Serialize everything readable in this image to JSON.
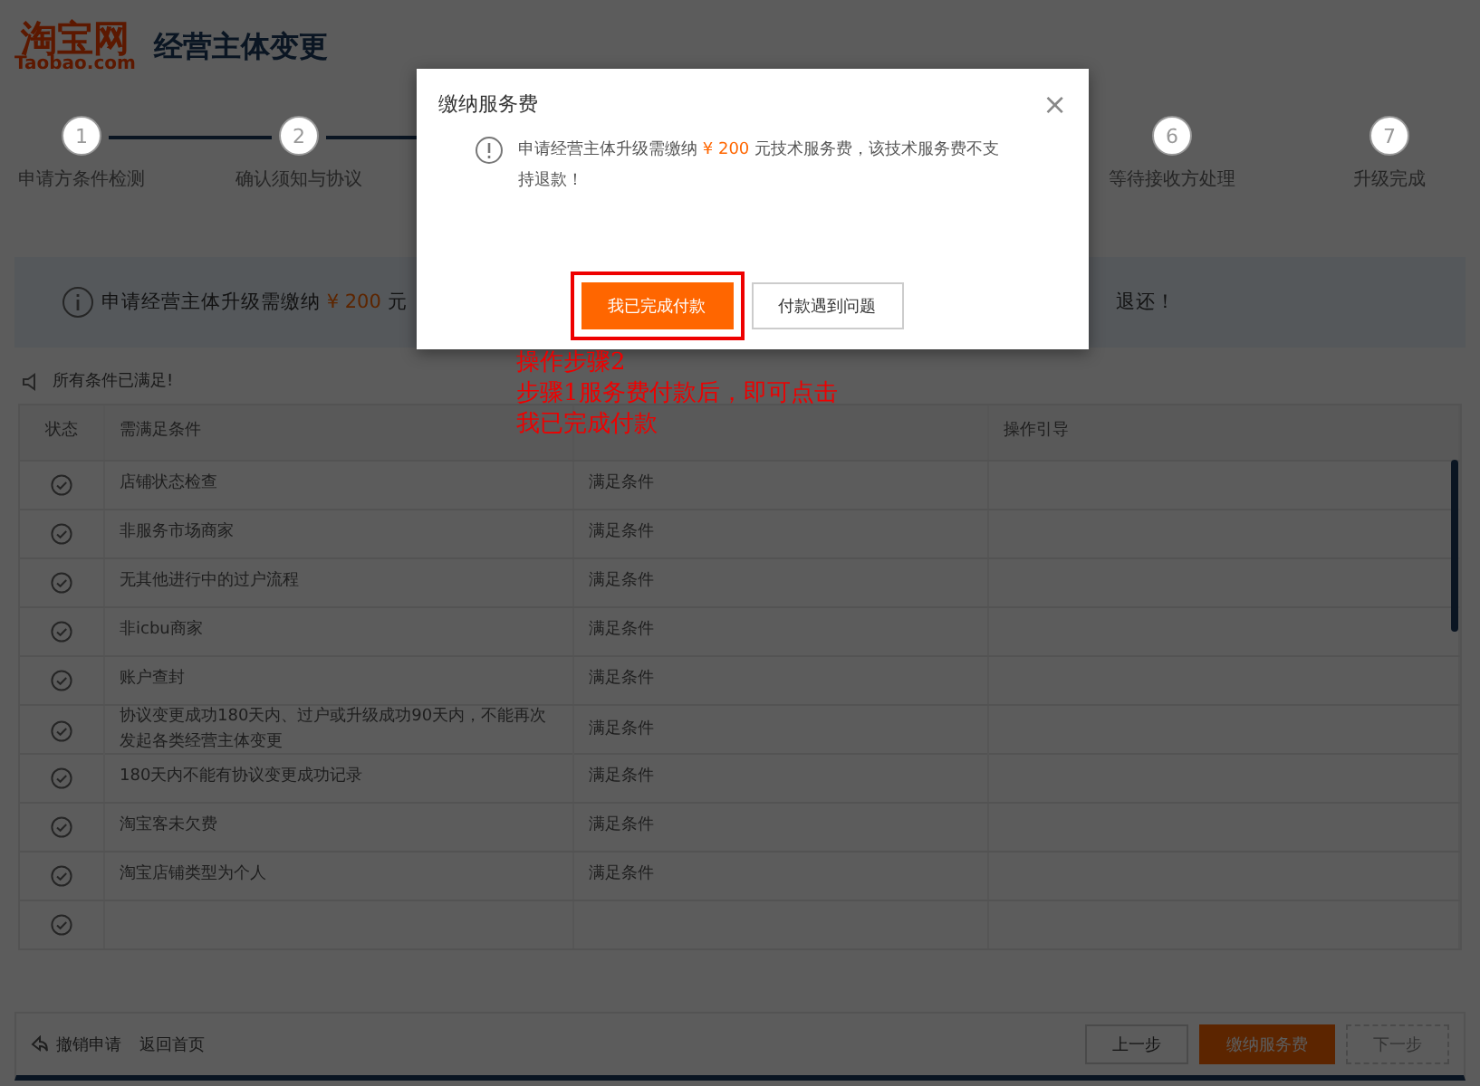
{
  "header": {
    "logo": "淘宝网",
    "logo_sub": "Taobao.com",
    "title": "经营主体变更"
  },
  "steps": {
    "left": [
      {
        "number": "1",
        "label": "申请方条件检测"
      },
      {
        "number": "2",
        "label": "确认须知与协议"
      }
    ],
    "right": [
      {
        "number": "6",
        "label": "等待接收方处理"
      },
      {
        "number": "7",
        "label": "升级完成"
      }
    ]
  },
  "notice": {
    "text_before": "申请经营主体升级需缴纳",
    "amount": "¥ 200",
    "text_after": "元",
    "text_end": "退还！"
  },
  "conditions_status": "所有条件已满足!",
  "table": {
    "columns": [
      "状态",
      "需满足条件",
      "操作引导"
    ],
    "rows": [
      {
        "passed": true,
        "condition": "店铺状态检查",
        "result": "满足条件"
      },
      {
        "passed": true,
        "condition": "非服务市场商家",
        "result": "满足条件"
      },
      {
        "passed": true,
        "condition": "无其他进行中的过户流程",
        "result": "满足条件"
      },
      {
        "passed": true,
        "condition": "非icbu商家",
        "result": "满足条件"
      },
      {
        "passed": true,
        "condition": "账户查封",
        "result": "满足条件"
      },
      {
        "passed": true,
        "condition": "协议变更成功180天内、过户或升级成功90天内，不能再次发起各类经营主体变更",
        "result": "满足条件"
      },
      {
        "passed": true,
        "condition": "180天内不能有协议变更成功记录",
        "result": "满足条件"
      },
      {
        "passed": true,
        "condition": "淘宝客未欠费",
        "result": "满足条件"
      },
      {
        "passed": true,
        "condition": "淘宝店铺类型为个人",
        "result": "满足条件"
      }
    ]
  },
  "footer": {
    "links": [
      "撤销申请",
      "返回首页"
    ],
    "buttons": [
      {
        "label": "上一步",
        "kind": "default"
      },
      {
        "label": "缴纳服务费",
        "kind": "primary"
      },
      {
        "label": "下一步",
        "kind": "disabled"
      }
    ]
  },
  "dialog": {
    "title": "缴纳服务费",
    "close": "×",
    "text_before": "申请经营主体升级需缴纳",
    "amount": "¥ 200",
    "text_after": "元技术服务费，该技术服务费不支持退款！",
    "buttons": [
      {
        "label": "我已完成付款",
        "kind": "primary",
        "highlighted": true
      },
      {
        "label": "付款遇到问题",
        "kind": "default",
        "highlighted": false
      }
    ]
  },
  "annotation": {
    "lines": [
      "操作步骤2",
      "步骤1服务费付款后，即可点击",
      "我已完成付款"
    ]
  }
}
